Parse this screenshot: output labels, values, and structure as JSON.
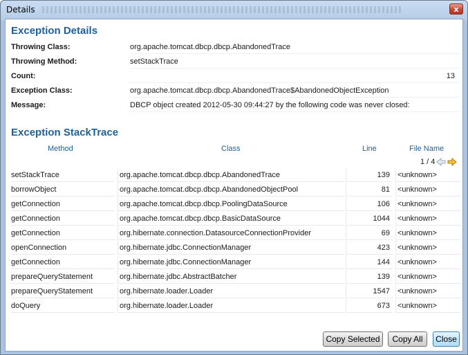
{
  "window": {
    "title": "Details",
    "close_glyph": "x"
  },
  "exception_details": {
    "heading": "Exception Details",
    "fields": [
      {
        "label": "Throwing Class:",
        "value": "org.apache.tomcat.dbcp.dbcp.AbandonedTrace"
      },
      {
        "label": "Throwing Method:",
        "value": "setStackTrace"
      },
      {
        "label": "Count:",
        "value": "13"
      },
      {
        "label": "Exception Class:",
        "value": "org.apache.tomcat.dbcp.dbcp.AbandonedTrace$AbandonedObjectException"
      },
      {
        "label": "Message:",
        "value": "DBCP object created 2012-05-30 09:44:27 by the following code was never closed:"
      }
    ]
  },
  "stacktrace": {
    "heading": "Exception StackTrace",
    "columns": {
      "method": "Method",
      "class": "Class",
      "line": "Line",
      "file": "File Name"
    },
    "pager": {
      "text": "1 / 4",
      "prev_icon": "arrow-left-icon",
      "next_icon": "arrow-right-icon"
    },
    "rows": [
      {
        "method": "setStackTrace",
        "class": "org.apache.tomcat.dbcp.dbcp.AbandonedTrace",
        "line": "139",
        "file": "<unknown>"
      },
      {
        "method": "borrowObject",
        "class": "org.apache.tomcat.dbcp.dbcp.AbandonedObjectPool",
        "line": "81",
        "file": "<unknown>"
      },
      {
        "method": "getConnection",
        "class": "org.apache.tomcat.dbcp.dbcp.PoolingDataSource",
        "line": "106",
        "file": "<unknown>"
      },
      {
        "method": "getConnection",
        "class": "org.apache.tomcat.dbcp.dbcp.BasicDataSource",
        "line": "1044",
        "file": "<unknown>"
      },
      {
        "method": "getConnection",
        "class": "org.hibernate.connection.DatasourceConnectionProvider",
        "line": "69",
        "file": "<unknown>"
      },
      {
        "method": "openConnection",
        "class": "org.hibernate.jdbc.ConnectionManager",
        "line": "423",
        "file": "<unknown>"
      },
      {
        "method": "getConnection",
        "class": "org.hibernate.jdbc.ConnectionManager",
        "line": "144",
        "file": "<unknown>"
      },
      {
        "method": "prepareQueryStatement",
        "class": "org.hibernate.jdbc.AbstractBatcher",
        "line": "139",
        "file": "<unknown>"
      },
      {
        "method": "prepareQueryStatement",
        "class": "org.hibernate.loader.Loader",
        "line": "1547",
        "file": "<unknown>"
      },
      {
        "method": "doQuery",
        "class": "org.hibernate.loader.Loader",
        "line": "673",
        "file": "<unknown>"
      }
    ]
  },
  "buttons": {
    "copy_selected": "Copy Selected",
    "copy_all": "Copy All",
    "close": "Close"
  },
  "colors": {
    "heading": "#1f5f99",
    "title_bar": "#b7cde8",
    "close_button": "#c8473a"
  }
}
